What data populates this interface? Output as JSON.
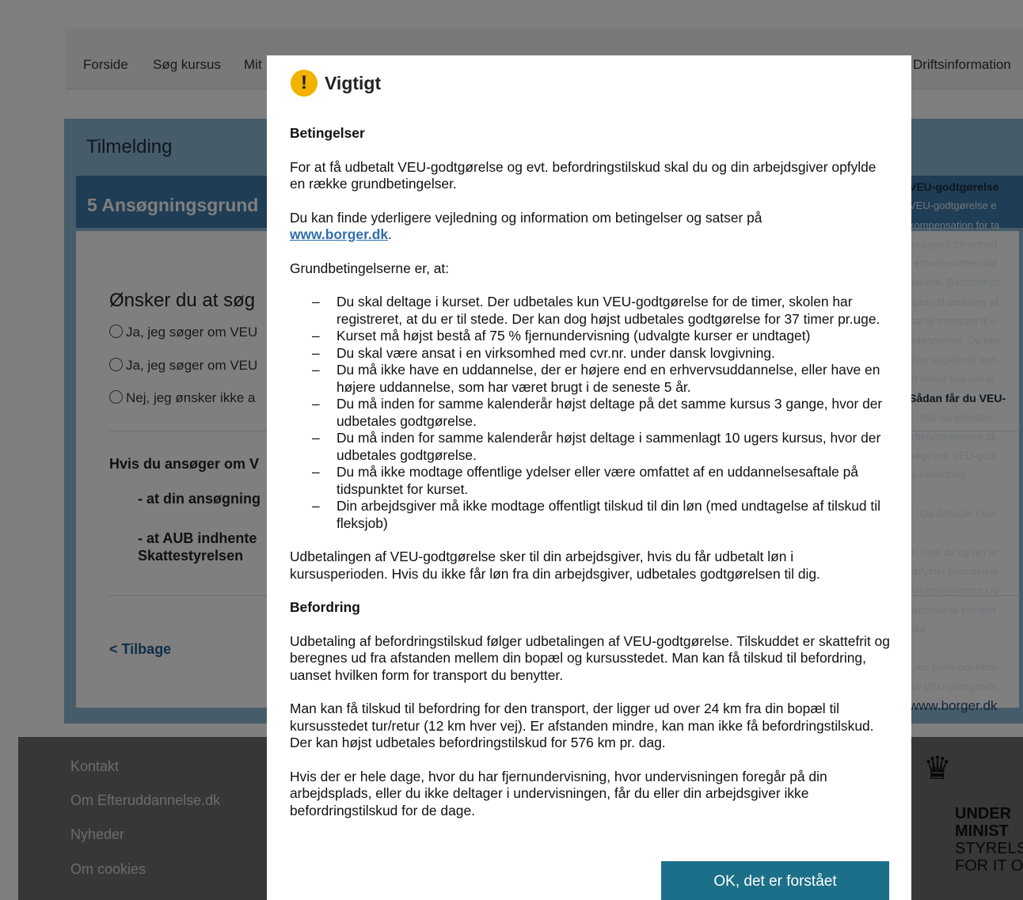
{
  "nav": {
    "items": [
      "Forside",
      "Søg kursus",
      "Mit",
      "Driftsinformation"
    ]
  },
  "card": {
    "title": "Tilmelding",
    "step": "5  Ansøgningsgrund",
    "question": "Ønsker du at søg",
    "radios": [
      "Ja, jeg søger om VEU",
      "Ja, jeg søger om VEU",
      "Nej, jeg ønsker ikke a"
    ],
    "info_heading": "Hvis du ansøger om V",
    "info_line1": "- at din ansøgning",
    "info_line2a": "- at AUB indhente",
    "info_line2b": "Skattestyrelsen",
    "back_label": "< Tilbage"
  },
  "side": {
    "heading": "VEU-godtgørelse",
    "lines": [
      "VEU-godtgørelse e",
      "kompensation for ta",
      "mulighed for arbejd",
      "i erhvervsrettet udd",
      "voksne. Befordrings",
      "hjælp til dækning af",
      "har til transport til o",
      "uddannelse. Du kan",
      "dine udgifter til tran",
      "er netop tale om et"
    ],
    "heading2": "Sådan får du VEU-",
    "lines2": [
      "1. Når du tilmelder",
      "efteruddannelse.dk",
      "søge om VEU-godt",
      "til befordring.",
      "",
      "2. Du deltager i kur",
      "",
      "3. Hvis du og din ar",
      "opfylder betingelser",
      "Arbejdsgivernes Ud",
      "automatisk pengen",
      "slut.",
      "",
      "Læs mere om betin",
      "for VEU-godtgørels"
    ],
    "link": "www.borger.dk"
  },
  "footer": {
    "links": [
      "Kontakt",
      "Om Efteruddannelse.dk",
      "Nyheder",
      "Om cookies"
    ]
  },
  "logo": {
    "line1": "UNDER",
    "line2": "MINIST",
    "line3": "STYRELS",
    "line4": "FOR IT O"
  },
  "modal": {
    "title": "Vigtigt",
    "h_conditions": "Betingelser",
    "p1": "For at få udbetalt VEU-godtgørelse og evt. befordringstilskud skal du og din arbejdsgiver opfylde en række grundbetingelser.",
    "p2_text": "Du kan finde yderligere vejledning og information om betingelser og satser på",
    "p2_link": "www.borger.dk",
    "p2_end": ".",
    "p3": "Grundbetingelserne er, at:",
    "list": [
      "Du skal deltage i kurset. Der udbetales kun VEU-godtgørelse for de timer, skolen har registreret, at du er til stede. Der kan dog højst udbetales godtgørelse for 37 timer pr.uge.",
      "Kurset må højst bestå af 75 % fjernundervisning (udvalgte kurser er undtaget)",
      "Du skal være ansat i en virksomhed med cvr.nr. under dansk lovgivning.",
      "Du må ikke have en uddannelse, der er højere end en erhvervsuddannelse, eller have en højere uddannelse, som har været brugt i de seneste 5 år.",
      "Du må inden for samme kalenderår højst deltage på det samme kursus 3 gange, hvor der udbetales godtgørelse.",
      "Du må inden for samme kalenderår højst deltage i sammenlagt 10 ugers kursus, hvor der udbetales godtgørelse.",
      "Du må ikke modtage offentlige ydelser eller være omfattet af en uddannelsesaftale på tidspunktet for kurset.",
      "Din arbejdsgiver må ikke modtage offentligt tilskud til din løn (med undtagelse af tilskud til fleksjob)"
    ],
    "p4": "Udbetalingen af VEU-godtgørelse sker til din arbejdsgiver, hvis du får udbetalt løn i kursusperioden. Hvis du ikke får løn fra din arbejdsgiver, udbetales godtgørelsen til dig.",
    "h_transport": "Befordring",
    "p5": "Udbetaling af befordringstilskud følger udbetalingen af VEU-godtgørelse. Tilskuddet er skattefrit og beregnes ud fra afstanden mellem din bopæl og kursusstedet. Man kan få tilskud til befordring, uanset hvilken form for transport du benytter.",
    "p6": "Man kan få tilskud til befordring for den transport, der ligger ud over 24 km fra din bopæl til kursusstedet tur/retur (12 km hver vej). Er afstanden mindre, kan man ikke få befordringstilskud. Der kan højst udbetales befordringstilskud for 576 km pr. dag.",
    "p7": "Hvis der er hele dage, hvor du har fjernundervisning, hvor undervisningen foregår på din arbejdsplads, eller du ikke deltager i undervisningen, får du eller din arbejdsgiver ikke befordringstilskud for de dage.",
    "ok_label": "OK, det er forstået"
  }
}
